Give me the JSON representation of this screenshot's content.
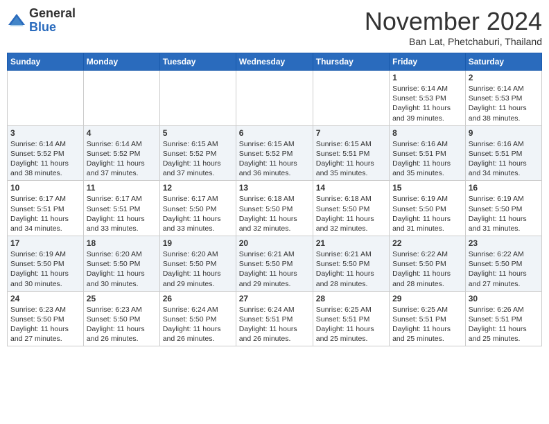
{
  "header": {
    "logo_general": "General",
    "logo_blue": "Blue",
    "month_title": "November 2024",
    "location": "Ban Lat, Phetchaburi, Thailand"
  },
  "weekdays": [
    "Sunday",
    "Monday",
    "Tuesday",
    "Wednesday",
    "Thursday",
    "Friday",
    "Saturday"
  ],
  "weeks": [
    [
      {
        "day": "",
        "info": ""
      },
      {
        "day": "",
        "info": ""
      },
      {
        "day": "",
        "info": ""
      },
      {
        "day": "",
        "info": ""
      },
      {
        "day": "",
        "info": ""
      },
      {
        "day": "1",
        "info": "Sunrise: 6:14 AM\nSunset: 5:53 PM\nDaylight: 11 hours and 39 minutes."
      },
      {
        "day": "2",
        "info": "Sunrise: 6:14 AM\nSunset: 5:53 PM\nDaylight: 11 hours and 38 minutes."
      }
    ],
    [
      {
        "day": "3",
        "info": "Sunrise: 6:14 AM\nSunset: 5:52 PM\nDaylight: 11 hours and 38 minutes."
      },
      {
        "day": "4",
        "info": "Sunrise: 6:14 AM\nSunset: 5:52 PM\nDaylight: 11 hours and 37 minutes."
      },
      {
        "day": "5",
        "info": "Sunrise: 6:15 AM\nSunset: 5:52 PM\nDaylight: 11 hours and 37 minutes."
      },
      {
        "day": "6",
        "info": "Sunrise: 6:15 AM\nSunset: 5:52 PM\nDaylight: 11 hours and 36 minutes."
      },
      {
        "day": "7",
        "info": "Sunrise: 6:15 AM\nSunset: 5:51 PM\nDaylight: 11 hours and 35 minutes."
      },
      {
        "day": "8",
        "info": "Sunrise: 6:16 AM\nSunset: 5:51 PM\nDaylight: 11 hours and 35 minutes."
      },
      {
        "day": "9",
        "info": "Sunrise: 6:16 AM\nSunset: 5:51 PM\nDaylight: 11 hours and 34 minutes."
      }
    ],
    [
      {
        "day": "10",
        "info": "Sunrise: 6:17 AM\nSunset: 5:51 PM\nDaylight: 11 hours and 34 minutes."
      },
      {
        "day": "11",
        "info": "Sunrise: 6:17 AM\nSunset: 5:51 PM\nDaylight: 11 hours and 33 minutes."
      },
      {
        "day": "12",
        "info": "Sunrise: 6:17 AM\nSunset: 5:50 PM\nDaylight: 11 hours and 33 minutes."
      },
      {
        "day": "13",
        "info": "Sunrise: 6:18 AM\nSunset: 5:50 PM\nDaylight: 11 hours and 32 minutes."
      },
      {
        "day": "14",
        "info": "Sunrise: 6:18 AM\nSunset: 5:50 PM\nDaylight: 11 hours and 32 minutes."
      },
      {
        "day": "15",
        "info": "Sunrise: 6:19 AM\nSunset: 5:50 PM\nDaylight: 11 hours and 31 minutes."
      },
      {
        "day": "16",
        "info": "Sunrise: 6:19 AM\nSunset: 5:50 PM\nDaylight: 11 hours and 31 minutes."
      }
    ],
    [
      {
        "day": "17",
        "info": "Sunrise: 6:19 AM\nSunset: 5:50 PM\nDaylight: 11 hours and 30 minutes."
      },
      {
        "day": "18",
        "info": "Sunrise: 6:20 AM\nSunset: 5:50 PM\nDaylight: 11 hours and 30 minutes."
      },
      {
        "day": "19",
        "info": "Sunrise: 6:20 AM\nSunset: 5:50 PM\nDaylight: 11 hours and 29 minutes."
      },
      {
        "day": "20",
        "info": "Sunrise: 6:21 AM\nSunset: 5:50 PM\nDaylight: 11 hours and 29 minutes."
      },
      {
        "day": "21",
        "info": "Sunrise: 6:21 AM\nSunset: 5:50 PM\nDaylight: 11 hours and 28 minutes."
      },
      {
        "day": "22",
        "info": "Sunrise: 6:22 AM\nSunset: 5:50 PM\nDaylight: 11 hours and 28 minutes."
      },
      {
        "day": "23",
        "info": "Sunrise: 6:22 AM\nSunset: 5:50 PM\nDaylight: 11 hours and 27 minutes."
      }
    ],
    [
      {
        "day": "24",
        "info": "Sunrise: 6:23 AM\nSunset: 5:50 PM\nDaylight: 11 hours and 27 minutes."
      },
      {
        "day": "25",
        "info": "Sunrise: 6:23 AM\nSunset: 5:50 PM\nDaylight: 11 hours and 26 minutes."
      },
      {
        "day": "26",
        "info": "Sunrise: 6:24 AM\nSunset: 5:50 PM\nDaylight: 11 hours and 26 minutes."
      },
      {
        "day": "27",
        "info": "Sunrise: 6:24 AM\nSunset: 5:51 PM\nDaylight: 11 hours and 26 minutes."
      },
      {
        "day": "28",
        "info": "Sunrise: 6:25 AM\nSunset: 5:51 PM\nDaylight: 11 hours and 25 minutes."
      },
      {
        "day": "29",
        "info": "Sunrise: 6:25 AM\nSunset: 5:51 PM\nDaylight: 11 hours and 25 minutes."
      },
      {
        "day": "30",
        "info": "Sunrise: 6:26 AM\nSunset: 5:51 PM\nDaylight: 11 hours and 25 minutes."
      }
    ]
  ]
}
